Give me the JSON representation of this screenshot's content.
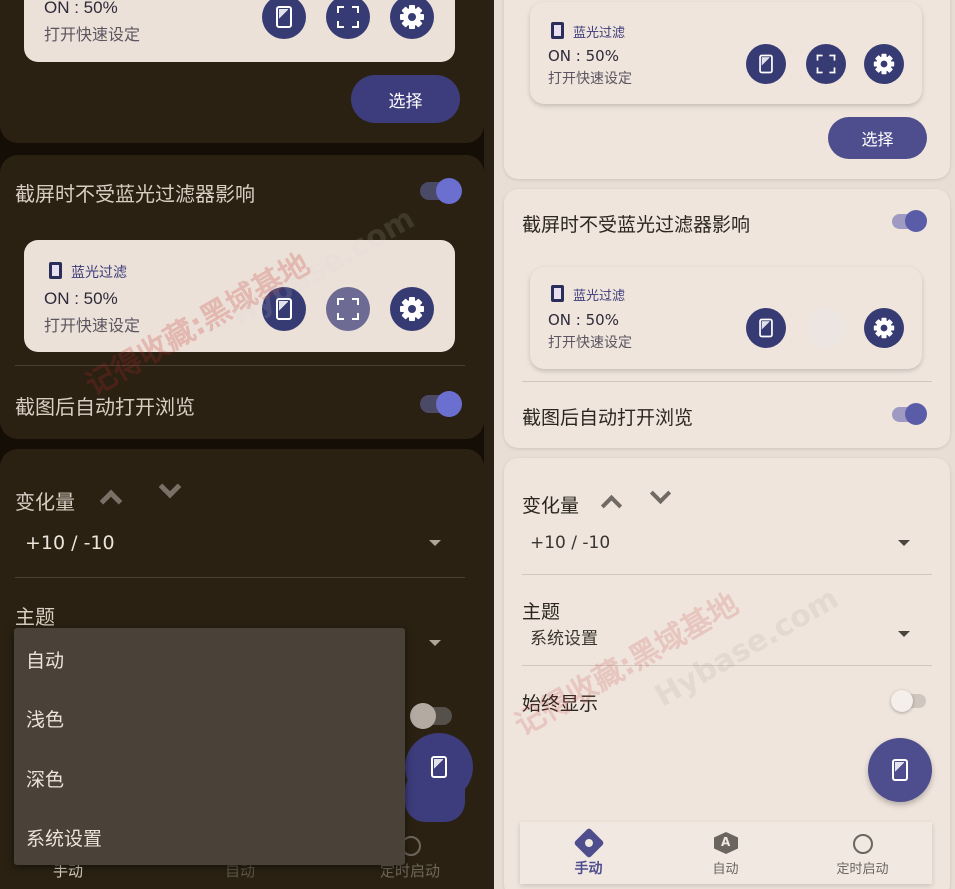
{
  "qs_tile": {
    "title": "蓝光过滤",
    "status": "ON : 50%",
    "subtitle": "打开快速设定"
  },
  "select_button": "选择",
  "settings": {
    "screenshot_exempt": "截屏时不受蓝光过滤器影响",
    "auto_open_preview": "截图后自动打开浏览",
    "change_amount_label": "变化量",
    "change_amount_value": "+10 / -10",
    "theme_label": "主题",
    "theme_value": "系统设置",
    "always_show": "始终显示"
  },
  "theme_menu": [
    "自动",
    "浅色",
    "深色",
    "系统设置"
  ],
  "nav": {
    "manual": "手动",
    "auto": "自动",
    "scheduled": "定时启动"
  },
  "watermark": {
    "text1": "记得收藏:黑域基地",
    "text2": "Hybase.com"
  },
  "colors": {
    "accent": "#3d3c7c",
    "toggle_on": "#6a6fd0",
    "dark_bg": "#140e06",
    "light_bg": "#e8ded6"
  }
}
